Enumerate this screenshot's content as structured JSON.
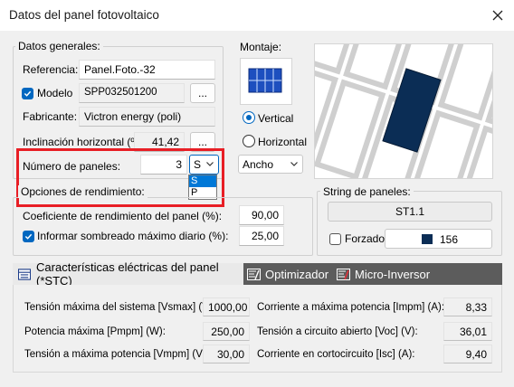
{
  "window": {
    "title": "Datos del panel fotovoltaico"
  },
  "general": {
    "group_label": "Datos generales:",
    "referencia_label": "Referencia:",
    "referencia_value": "Panel.Foto.-32",
    "modelo_label": "Modelo",
    "modelo_checked": true,
    "modelo_value": "SPP032501200",
    "ellipsis": "...",
    "fabricante_label": "Fabricante:",
    "fabricante_value": "Victron energy (poli)",
    "inclinacion_label": "Inclinación horizontal (º):",
    "inclinacion_value": "41,42",
    "num_paneles_label": "Número de paneles:",
    "num_paneles_value": "3",
    "orientation_selected": "S",
    "orientation_options": [
      "S",
      "P"
    ]
  },
  "montaje": {
    "label": "Montaje:",
    "vertical_label": "Vertical",
    "horizontal_label": "Horizontal",
    "selected": "Vertical",
    "ancho_value": "Ancho"
  },
  "rendimiento": {
    "group_label": "Opciones de rendimiento:",
    "coef_label": "Coeficiente de rendimiento del panel (%):",
    "coef_value": "90,00",
    "sombreado_label": "Informar sombreado máximo diario (%):",
    "sombreado_checked": true,
    "sombreado_value": "25,00"
  },
  "string": {
    "group_label": "String de paneles:",
    "string_value": "ST1.1",
    "forzado_label": "Forzado",
    "forzado_checked": false,
    "color_value": "156",
    "color_swatch": "#0b2d55"
  },
  "tabs": [
    {
      "label": "Características eléctricas del panel (*STC)",
      "icon": "table-icon",
      "active": true
    },
    {
      "label": "Optimizador",
      "icon": "optimizer-icon",
      "active": false
    },
    {
      "label": "Micro-Inversor",
      "icon": "micro-inverter-icon",
      "active": false
    }
  ],
  "electrical": {
    "vsmax_label": "Tensión máxima del sistema [Vsmax] (V):",
    "vsmax_value": "1000,00",
    "pmpm_label": "Potencia máxima [Pmpm] (W):",
    "pmpm_value": "250,00",
    "vmpm_label": "Tensión a máxima potencia [Vmpm] (V):",
    "vmpm_value": "30,00",
    "impm_label": "Corriente a máxima potencia [Impm] (A):",
    "impm_value": "8,33",
    "voc_label": "Tensión a circuito abierto [Voc] (V):",
    "voc_value": "36,01",
    "isc_label": "Corriente en cortocircuito [Isc] (A):",
    "isc_value": "9,40"
  },
  "colors": {
    "accent": "#0067c0",
    "highlight": "#e81e25",
    "tab_strip": "#5c5c5c",
    "panel_fill": "#0b2d55"
  }
}
